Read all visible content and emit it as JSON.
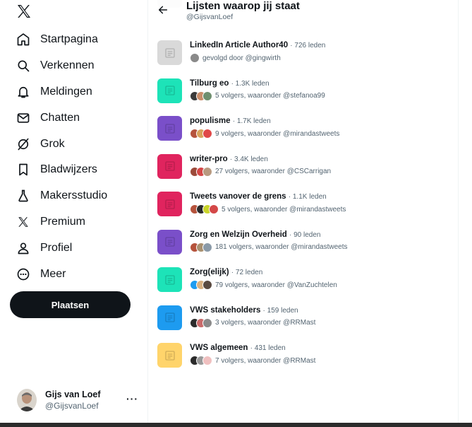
{
  "app": {
    "logo_icon": "x-logo-icon"
  },
  "nav": {
    "items": [
      {
        "label": "Startpagina",
        "icon": "home-icon"
      },
      {
        "label": "Verkennen",
        "icon": "search-icon"
      },
      {
        "label": "Meldingen",
        "icon": "bell-icon"
      },
      {
        "label": "Chatten",
        "icon": "envelope-icon"
      },
      {
        "label": "Grok",
        "icon": "grok-icon"
      },
      {
        "label": "Bladwijzers",
        "icon": "bookmark-icon"
      },
      {
        "label": "Makersstudio",
        "icon": "flask-icon"
      },
      {
        "label": "Premium",
        "icon": "x-premium-icon"
      },
      {
        "label": "Profiel",
        "icon": "person-icon"
      },
      {
        "label": "Meer",
        "icon": "more-circle-icon"
      }
    ],
    "post_label": "Plaatsen"
  },
  "account": {
    "name": "Gijs van Loef",
    "handle": "@GijsvanLoef",
    "more": "···"
  },
  "header": {
    "title": "Lijsten waarop jij staat",
    "handle": "@GijsvanLoef",
    "back_icon": "arrow-left-icon"
  },
  "lists": [
    {
      "name": "LinkedIn Article Author40",
      "meta": "· 726 leden",
      "sub": "gevolgd door @gingwirth",
      "color": "#d9d9d9",
      "faces": [
        "#8a8a8a"
      ]
    },
    {
      "name": "Tilburg eo",
      "meta": "· 1.3K leden",
      "sub": "5 volgers, waaronder @stefanoa99",
      "color": "#1de3b8",
      "faces": [
        "#3a3a3a",
        "#c98d6a",
        "#6f8f6f"
      ]
    },
    {
      "name": "populisme",
      "meta": "· 1.7K leden",
      "sub": "9 volgers, waaronder @mirandastweets",
      "color": "#7a4fc9",
      "faces": [
        "#b5533c",
        "#d8a25a",
        "#e04848"
      ]
    },
    {
      "name": "writer-pro",
      "meta": "· 3.4K leden",
      "sub": "27 volgers, waaronder @CSCarrigan",
      "color": "#e0245e",
      "faces": [
        "#9c4a3a",
        "#d44848",
        "#b89a80"
      ]
    },
    {
      "name": "Tweets vanover de grens",
      "meta": "· 1.1K leden",
      "sub": "5 volgers, waaronder @mirandastweets",
      "color": "#e0245e",
      "faces": [
        "#b5533c",
        "#2b2b2b",
        "#c9d42a",
        "#d44848"
      ]
    },
    {
      "name": "Zorg en Welzijn Overheid",
      "meta": "· 90 leden",
      "sub": "181 volgers, waaronder @mirandastweets",
      "color": "#7a4fc9",
      "faces": [
        "#b5533c",
        "#a89070",
        "#8a9aa8"
      ]
    },
    {
      "name": "Zorg(elijk)",
      "meta": "· 72 leden",
      "sub": "79 volgers, waaronder @VanZuchtelen",
      "color": "#1de3b8",
      "faces": [
        "#1d9bf0",
        "#d8b080",
        "#5a4a40"
      ]
    },
    {
      "name": "VWS stakeholders",
      "meta": "· 159 leden",
      "sub": "3 volgers, waaronder @RRMast",
      "color": "#1d9bf0",
      "faces": [
        "#2b2b2b",
        "#c96a6a",
        "#8a8a8a"
      ]
    },
    {
      "name": "VWS algemeen",
      "meta": "· 431 leden",
      "sub": "7 volgers, waaronder @RRMast",
      "color": "#ffd46b",
      "faces": [
        "#2b2b2b",
        "#9a9a9a",
        "#f0c0c0"
      ]
    }
  ]
}
